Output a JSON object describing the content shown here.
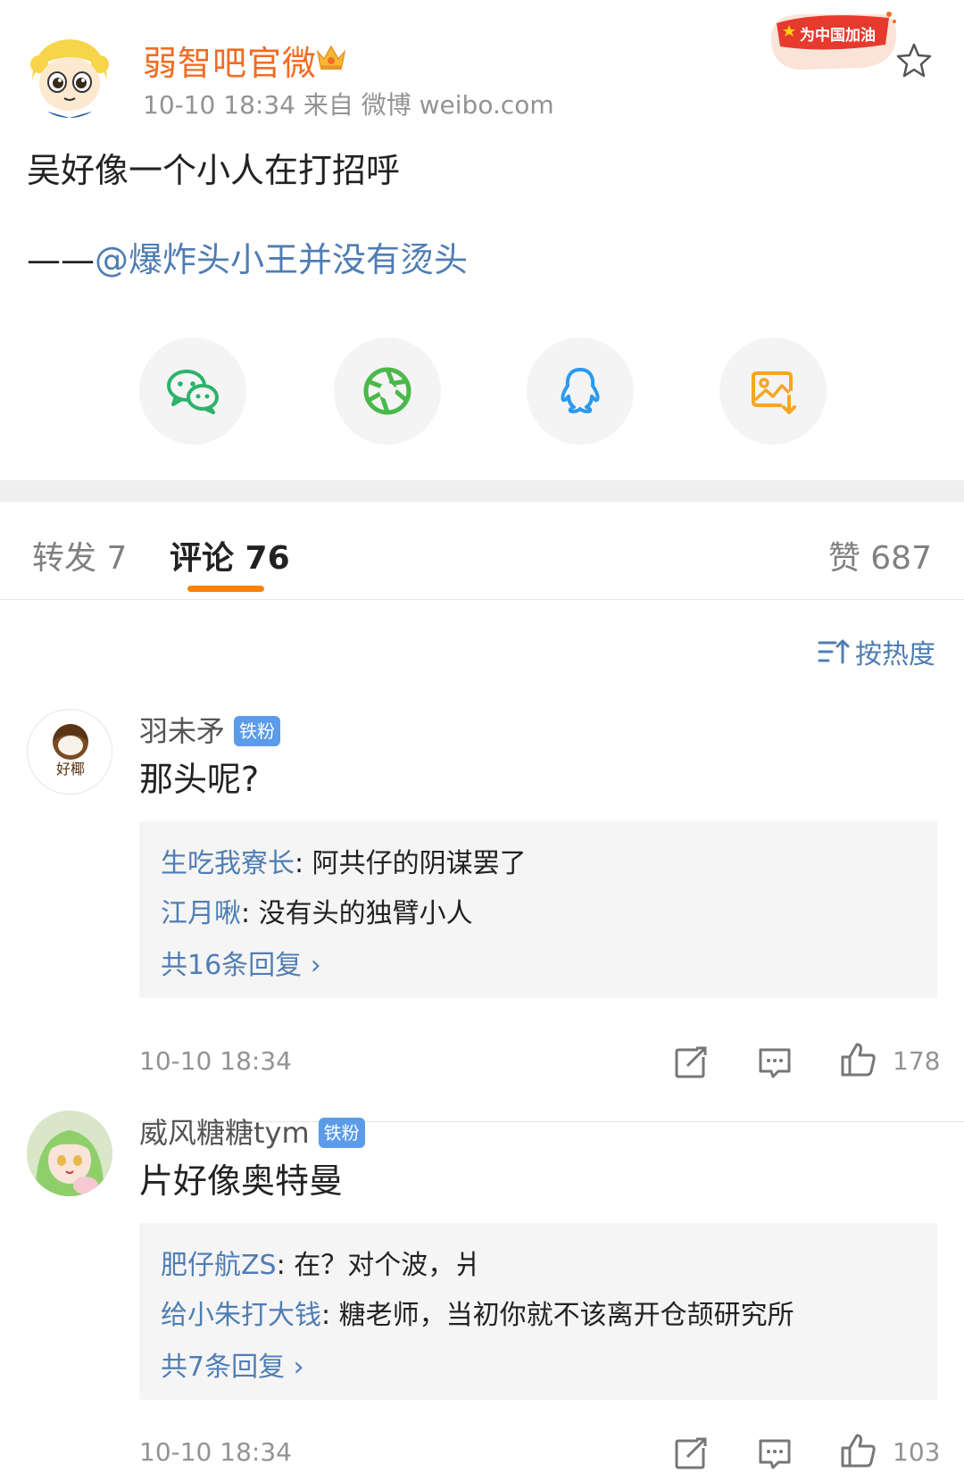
{
  "post": {
    "author": "弱智吧官微",
    "meta": "10-10 18:34   来自 微博 weibo.com",
    "banner_text": "为中国加油",
    "text": "吴好像一个小人在打招呼",
    "credit_prefix": "——",
    "credit_link": "@爆炸头小王并没有烫头"
  },
  "share": [
    "wechat-icon",
    "moments-icon",
    "qq-icon",
    "save-image-icon"
  ],
  "tabs": {
    "repost": "转发 7",
    "comments": "评论 76",
    "likes": "赞 687"
  },
  "sort_label": "按热度",
  "comments": [
    {
      "avatar_text": "好椰",
      "user": "羽未矛",
      "badge": "铁粉",
      "text": "那头呢?",
      "replies": [
        {
          "user": "生吃我寮长",
          "text": ": 阿共仔的阴谋罢了"
        },
        {
          "user": "江月啾",
          "text": ": 没有头的独臂小人"
        }
      ],
      "more": "共16条回复 ›",
      "time": "10-10 18:34",
      "likes": "178"
    },
    {
      "user": "威风糖糖tym",
      "badge": "铁粉",
      "text": "片好像奥特曼",
      "replies": [
        {
          "user": "肥仔航ZS",
          "text": ": 在？对个波，爿"
        },
        {
          "user": "给小朱打大钱",
          "text": ": 糖老师，当初你就不该离开仓颉研究所"
        }
      ],
      "more": "共7条回复 ›",
      "time": "10-10 18:34",
      "likes": "103"
    }
  ],
  "colors": {
    "accent": "#ff8200",
    "link": "#4f7db3",
    "author": "#f26b22",
    "badge": "#5b9be8"
  }
}
